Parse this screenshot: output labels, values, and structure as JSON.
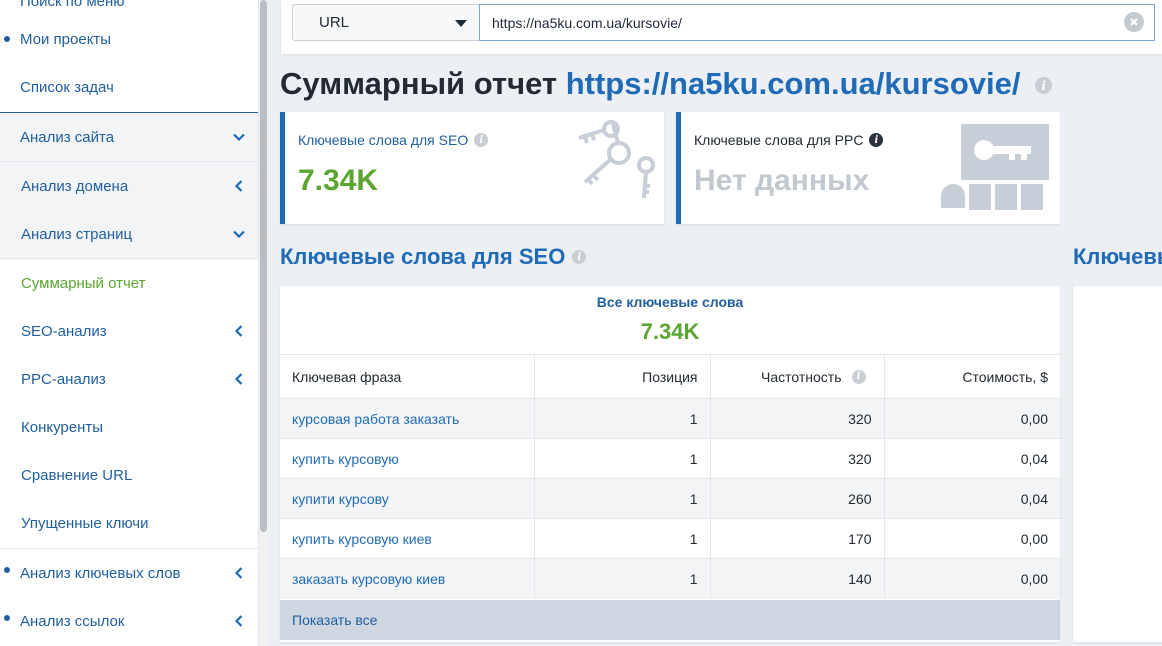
{
  "sidebar": {
    "items": [
      {
        "label": "Поиск по меню"
      },
      {
        "label": "Мои проекты"
      },
      {
        "label": "Список задач"
      },
      {
        "label": "Анализ сайта"
      },
      {
        "label": "Анализ домена"
      },
      {
        "label": "Анализ страниц"
      },
      {
        "label": "Суммарный отчет"
      },
      {
        "label": "SEO-анализ"
      },
      {
        "label": "PPC-анализ"
      },
      {
        "label": "Конкуренты"
      },
      {
        "label": "Сравнение URL"
      },
      {
        "label": "Упущенные ключи"
      },
      {
        "label": "Анализ ключевых слов"
      },
      {
        "label": "Анализ ссылок"
      }
    ]
  },
  "search": {
    "type_label": "URL",
    "url_value": "https://na5ku.com.ua/kursovie/"
  },
  "page": {
    "title_prefix": "Суммарный отчет",
    "title_url": "https://na5ku.com.ua/kursovie/"
  },
  "cards": {
    "seo": {
      "label": "Ключевые слова для SEO",
      "value": "7.34K"
    },
    "ppc": {
      "label": "Ключевые слова для PPC",
      "value": "Нет данных"
    }
  },
  "section": {
    "seo_title": "Ключевые слова для SEO",
    "right_title": "Ключевы"
  },
  "seo_table": {
    "summary_label": "Все ключевые слова",
    "summary_value": "7.34K",
    "headers": [
      "Ключевая фраза",
      "Позиция",
      "Частотность",
      "Стоимость, $"
    ],
    "rows": [
      {
        "phrase": "курсовая работа заказать",
        "position": "1",
        "frequency": "320",
        "cost": "0,00"
      },
      {
        "phrase": "купить курсовую",
        "position": "1",
        "frequency": "320",
        "cost": "0,04"
      },
      {
        "phrase": "купити курсову",
        "position": "1",
        "frequency": "260",
        "cost": "0,04"
      },
      {
        "phrase": "купить курсовую киев",
        "position": "1",
        "frequency": "170",
        "cost": "0,00"
      },
      {
        "phrase": "заказать курсовую киев",
        "position": "1",
        "frequency": "140",
        "cost": "0,00"
      }
    ],
    "show_all": "Показать все"
  },
  "colors": {
    "accent_blue": "#1f6bb5",
    "value_green": "#5aa630"
  }
}
